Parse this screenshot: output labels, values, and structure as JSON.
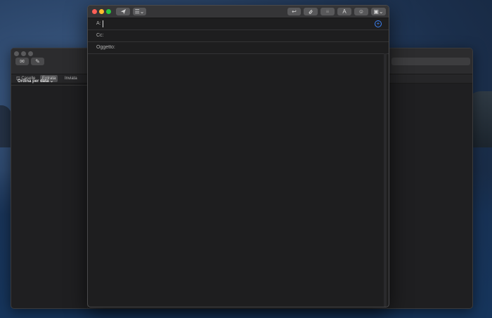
{
  "back_window": {
    "favorites": {
      "mailboxes": "Caselle",
      "inbox": "Entrata",
      "sent": "Inviata"
    },
    "sort_label": "Ordina per data"
  },
  "compose": {
    "fields": {
      "to_label": "A:",
      "cc_label": "Cc:",
      "subject_label": "Oggetto:"
    }
  },
  "icons": {
    "send": "paper-plane-icon",
    "header_fields": "list-chevron-icon",
    "reply": "reply-arrow-icon",
    "attach": "paperclip-icon",
    "format_bar": "format-bar-icon",
    "font": "letter-a-icon",
    "emoji": "smiley-icon",
    "photo": "photo-icon",
    "add_contact": "plus-circle-icon"
  },
  "colors": {
    "close": "#fe5f57",
    "minimize": "#febc2e",
    "maximize": "#28c840",
    "accent": "#3b82f6"
  }
}
